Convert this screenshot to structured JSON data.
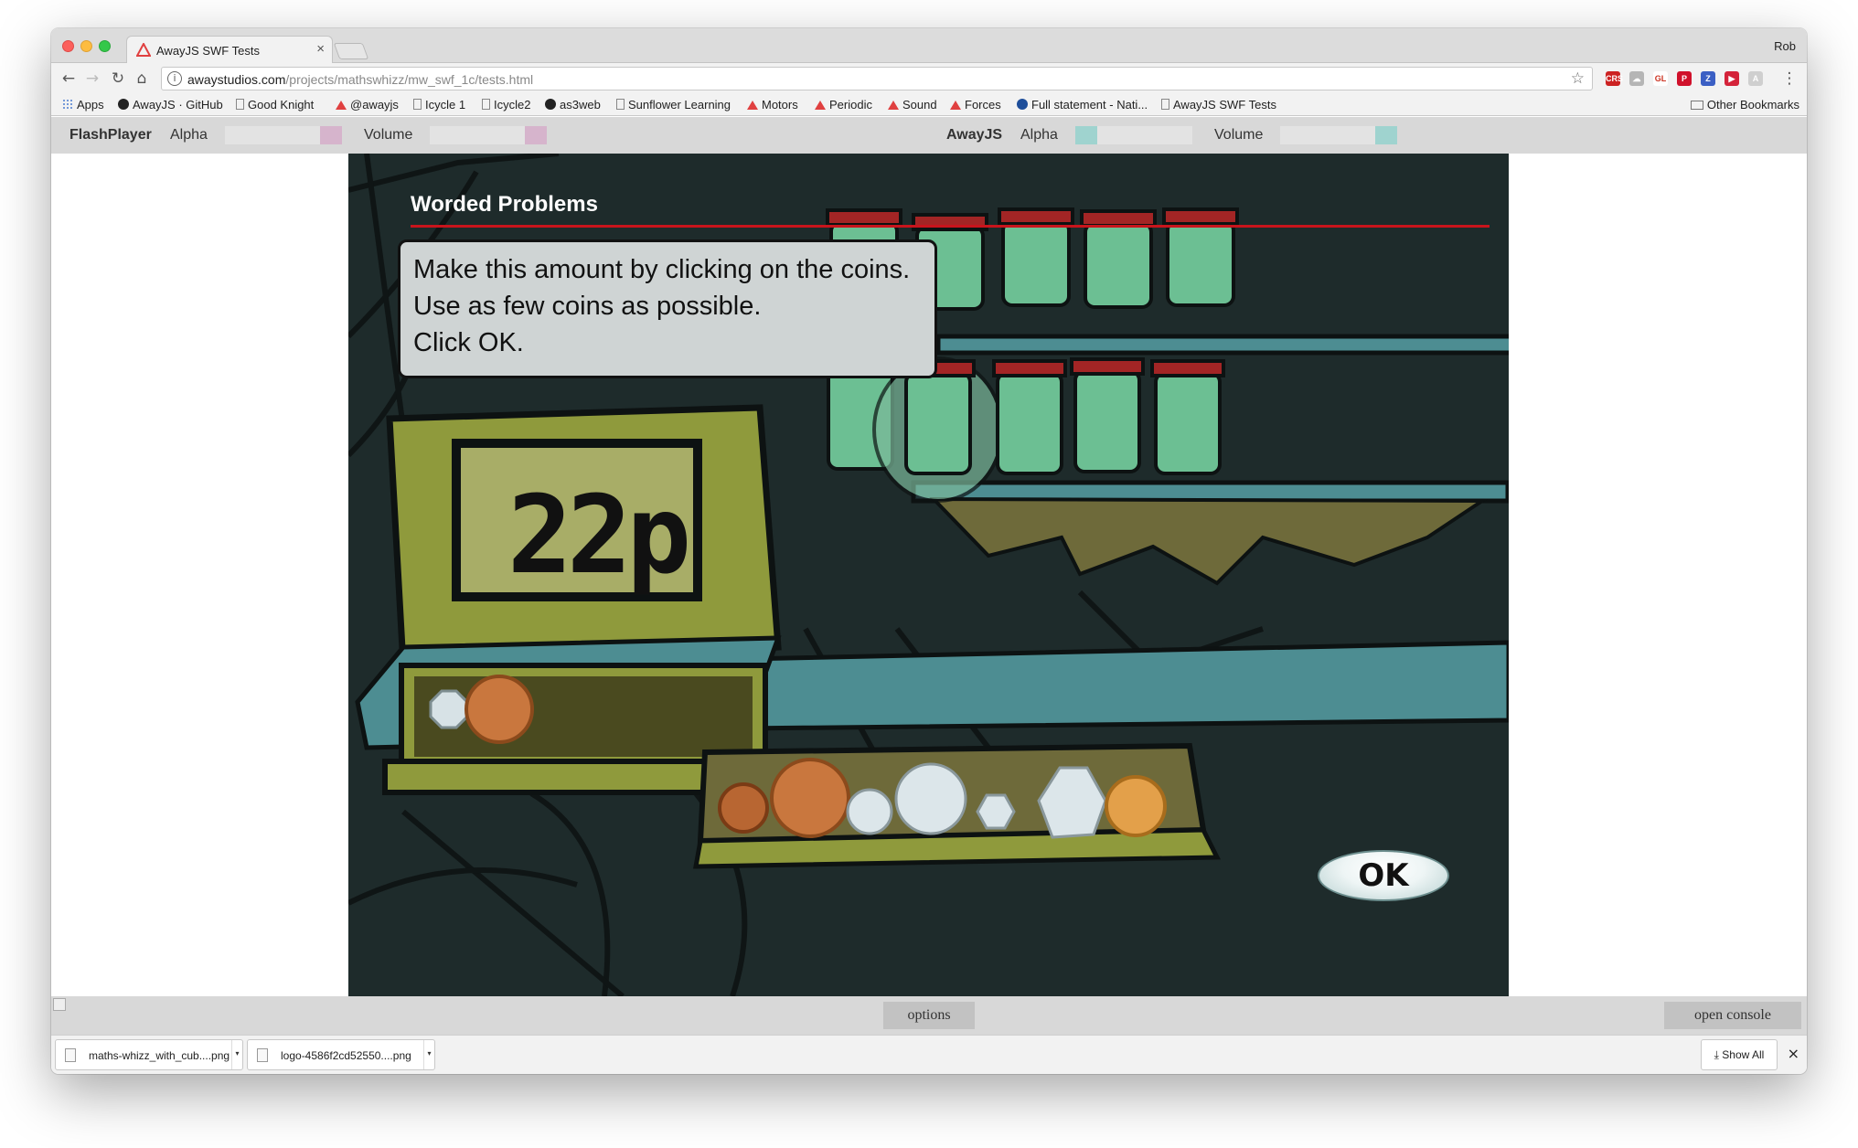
{
  "browser": {
    "tab_title": "AwayJS SWF Tests",
    "tab_close": "×",
    "profile_name": "Rob",
    "url_host": "awaystudios.com",
    "url_path": "/projects/mathswhizz/mw_swf_1c/tests.html",
    "nav_back": "←",
    "nav_forward": "→",
    "nav_reload": "↻",
    "nav_home": "⌂",
    "star": "☆",
    "info": "i",
    "menu": "⋮",
    "extensions": [
      {
        "label": "CRS",
        "color": "#cc2222"
      },
      {
        "label": "☁",
        "color": "#b5b5b5"
      },
      {
        "label": "GL",
        "color": "#ffffff"
      },
      {
        "label": "P",
        "color": "#d0112b"
      },
      {
        "label": "Z",
        "color": "#3b5fc4"
      },
      {
        "label": "▶",
        "color": "#d4233a"
      },
      {
        "label": "A",
        "color": "#cfcfcf"
      }
    ]
  },
  "bookmarks": {
    "items": [
      "Apps",
      "AwayJS · GitHub",
      "Good Knight",
      "@awayjs",
      "Icycle 1",
      "Icycle2",
      "as3web",
      "Sunflower Learning",
      "Motors",
      "Periodic",
      "Sound",
      "Forces",
      "Full statement - Nati...",
      "AwayJS SWF Tests"
    ],
    "other": "Other Bookmarks"
  },
  "controls": {
    "left_title": "FlashPlayer",
    "left_alpha": "Alpha",
    "left_volume": "Volume",
    "right_title": "AwayJS",
    "right_alpha": "Alpha",
    "right_volume": "Volume",
    "colors": {
      "flash": "#d6b4cc",
      "away": "#9fd3cf"
    }
  },
  "game": {
    "title": "Worded Problems",
    "instructions": [
      "Make this amount by clicking on the coins.",
      "Use as few coins as possible.",
      "Click OK."
    ],
    "amount": "22p",
    "ok_label": "OK",
    "selected_coins": [
      "20p",
      "2p"
    ],
    "tray_coins": [
      "1p",
      "2p",
      "5p",
      "10p",
      "20p",
      "50p",
      "£1"
    ]
  },
  "bottom": {
    "options_label": "options",
    "console_label": "open console"
  },
  "downloads": {
    "items": [
      "maths-whizz_with_cub....png",
      "logo-4586f2cd52550....png"
    ],
    "show_all": "Show All",
    "close": "×"
  }
}
